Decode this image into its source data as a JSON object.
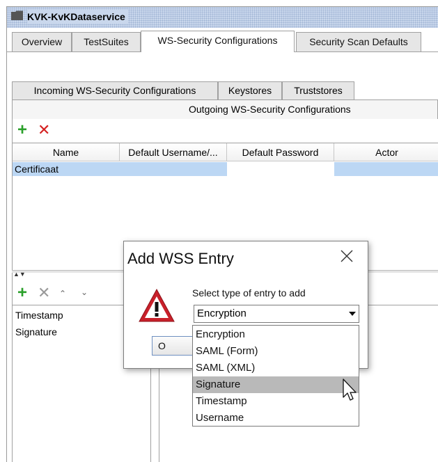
{
  "window": {
    "title": "KVK-KvKDataservice"
  },
  "tabs": [
    "Overview",
    "TestSuites",
    "WS-Security Configurations",
    "Security Scan Defaults"
  ],
  "inner_tabs": [
    "Incoming WS-Security Configurations",
    "Keystores",
    "Truststores"
  ],
  "outgoing_tab": "Outgoing WS-Security Configurations",
  "table": {
    "columns": [
      "Name",
      "Default Username/...",
      "Default Password",
      "Actor"
    ],
    "rows": [
      [
        "Certificaat",
        "",
        "",
        ""
      ]
    ]
  },
  "lower_list": [
    "Timestamp",
    "Signature"
  ],
  "dialog": {
    "title": "Add WSS Entry",
    "prompt": "Select type of entry to add",
    "selected": "Encryption",
    "button_label": "O",
    "options": [
      "Encryption",
      "SAML (Form)",
      "SAML (XML)",
      "Signature",
      "Timestamp",
      "Username"
    ],
    "hovered_option": "Signature"
  },
  "icons": {
    "title": "folder-icon",
    "add": "plus-icon",
    "remove": "x-icon",
    "warning": "warning-icon",
    "close": "close-icon",
    "cursor": "mouse-pointer-icon"
  },
  "colors": {
    "title_bg": "#c9d7ec",
    "selected_row": "#bcd7f4",
    "add_green": "#2ba02b",
    "remove_red": "#d42020",
    "warning_red": "#c8202a",
    "hover_option": "#b9b9b9"
  }
}
